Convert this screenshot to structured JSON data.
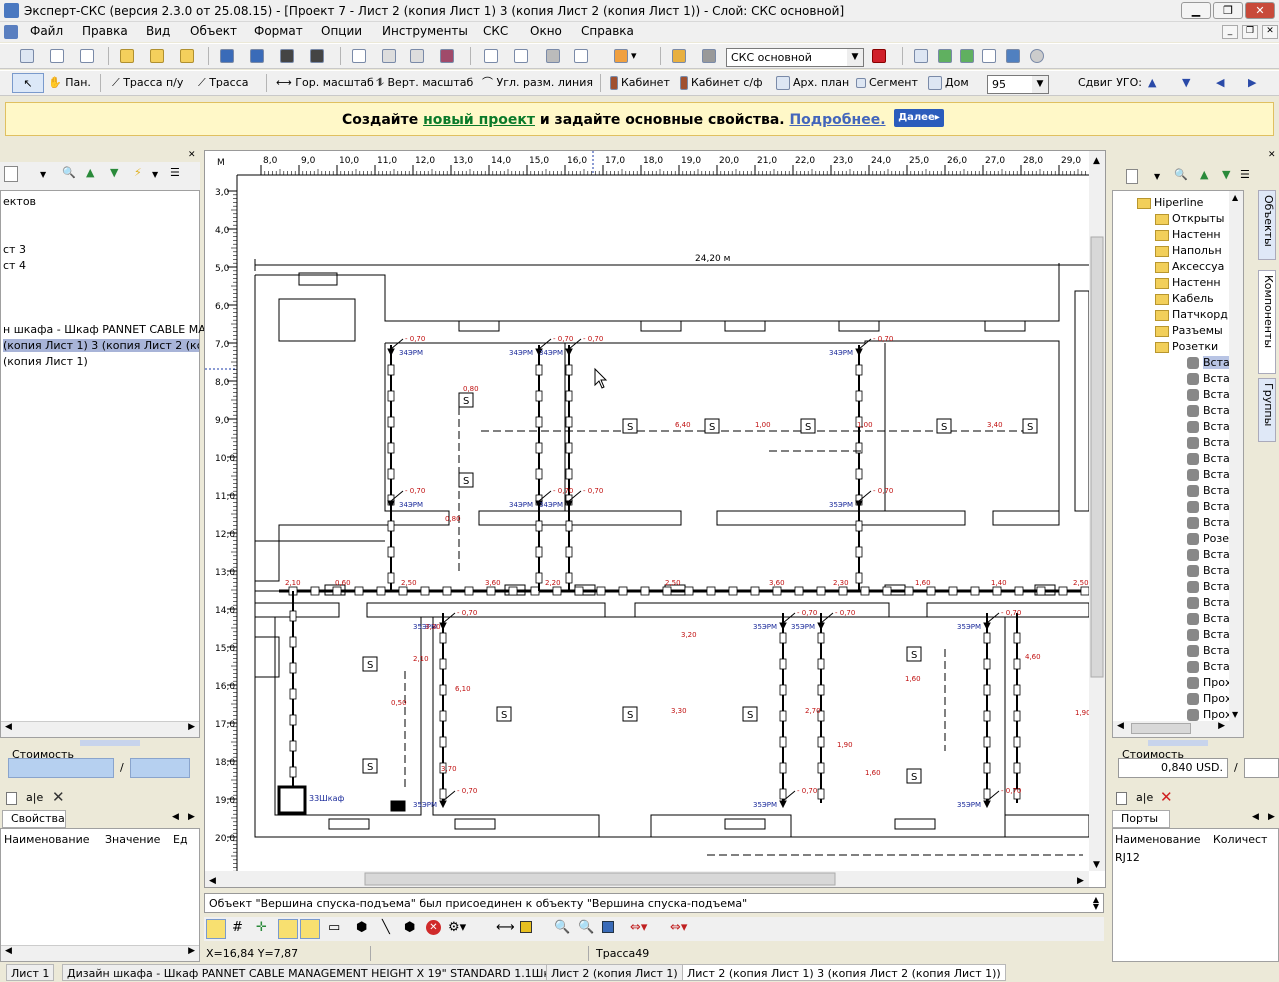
{
  "window": {
    "title": "Эксперт-СКС (версия  2.3.0 от 25.08.15) - [Проект 7 - Лист 2 (копия  Лист 1) 3 (копия  Лист 2 (копия  Лист 1))  - Слой: СКС основной]"
  },
  "menu": [
    "Файл",
    "Правка",
    "Вид",
    "Объект",
    "Формат",
    "Опции",
    "Инструменты",
    "СКС",
    "Окно",
    "Справка"
  ],
  "toolbar2": {
    "layer_value": "СКС основной",
    "tools": [
      "Пан.",
      "Трасса п/у",
      "Трасса",
      "Гор. масштаб",
      "Верт. масштаб",
      "Угл. разм. линия",
      "Кабинет",
      "Кабинет с/ф",
      "Арх. план",
      "Сегмент",
      "Дом"
    ],
    "zoom_value": "95",
    "shift_label": "Сдвиг УГО:"
  },
  "banner": {
    "part1": "Создайте",
    "link1": "новый проект",
    "part2": "и задайте основные свойства.",
    "link2": "Подробнее.",
    "next_label": "Далее"
  },
  "left_panel": {
    "items": [
      "ектов",
      "",
      "ст 3",
      "ст 4",
      "",
      "",
      "н шкафа - Шкаф PANNET CABLE MANA",
      "(копия  Лист 1) 3 (копия  Лист 2 (копи",
      "(копия  Лист 1)"
    ],
    "cost_label": "Стоимость",
    "cost_sep": "/",
    "props_tab": "Свойства",
    "props_cols": [
      "Наименование",
      "Значение",
      "Ед"
    ]
  },
  "canvas": {
    "unit": "М",
    "x_ticks": [
      "8,0",
      "9,0",
      "10,0",
      "11,0",
      "12,0",
      "13,0",
      "14,0",
      "15,0",
      "16,0",
      "17,0",
      "18,0",
      "19,0",
      "20,0",
      "21,0",
      "22,0",
      "23,0",
      "24,0",
      "25,0",
      "26,0",
      "27,0",
      "28,0",
      "29,0"
    ],
    "y_ticks": [
      "3,0",
      "4,0",
      "5,0",
      "6,0",
      "7,0",
      "8,0",
      "9,0",
      "10,0",
      "11,0",
      "12,0",
      "13,0",
      "14,0",
      "15,0",
      "16,0",
      "17,0",
      "18,0",
      "19,0",
      "20,0"
    ],
    "dimension_label": "24,20 м",
    "message": "Объект \"Вершина спуска-подъема\" был присоединен к объекту \"Вершина спуска-подъема\""
  },
  "right_panel": {
    "side_tabs": [
      "Объекты",
      "Компоненты",
      "Группы"
    ],
    "tree_root": "Hiperline",
    "tree_folders": [
      "Открыты",
      "Настенн",
      "Напольн",
      "Аксессуа",
      "Настенн",
      "Кабель",
      "Патчкорд",
      "Разъемы",
      "Розетки"
    ],
    "tree_items": [
      "Встав",
      "Встав",
      "Встав",
      "Встав",
      "Встав",
      "Встав",
      "Встав",
      "Встав",
      "Встав",
      "Встав",
      "Встав",
      "Розе",
      "Встав",
      "Встав",
      "Встав",
      "Встав",
      "Встав",
      "Встав",
      "Встав",
      "Встав",
      "Прох",
      "Прох",
      "Прох"
    ],
    "cost_label": "Стоимость",
    "cost_value": "0,840 USD.",
    "cost_sep": "/",
    "ports_tab": "Порты",
    "ports_cols": [
      "Наименование",
      "Количест"
    ],
    "ports_rows": [
      "RJ12"
    ]
  },
  "status": {
    "coords": "X=16,84  Y=7,87",
    "object": "Трасса49"
  },
  "tabs": [
    "Лист 1",
    "Дизайн шкафа - Шкаф PANNET CABLE MANAGEMENT HEIGHT X 19\" STANDARD 1.1Шкаф",
    "Лист 2 (копия  Лист 1)",
    "Лист 2 (копия  Лист 1) 3 (копия  Лист 2 (копия  Лист 1))"
  ],
  "drawing_labels": {
    "len_070": "0,70",
    "red_marks": [
      "2,10",
      "0,60",
      "2,50",
      "3,60",
      "2,20",
      "2,50",
      "3,60",
      "2,30",
      "1,60",
      "1,40",
      "2,50",
      "0,80",
      "6,40",
      "1,00",
      "1,00",
      "3,40",
      "0,80",
      "3,30",
      "2,10",
      "6,10",
      "0,50",
      "3,30",
      "3,20",
      "2,70",
      "1,90",
      "1,60",
      "3,70",
      "4,60",
      "1,60",
      "1,90"
    ],
    "outlets": [
      "34ЭРМ",
      "34ЭРМ",
      "34ЭРМ",
      "34ЭРМ",
      "34ЭРМ",
      "34ЭРМ",
      "34ЭРМ",
      "35ЭРМ",
      "35ЭРМ",
      "35ЭРМ",
      "35ЭРМ",
      "35ЭРМ",
      "35ЭРМ",
      "35ЭРМ",
      "35ЭРМ"
    ],
    "cabinet": "33Шкаф"
  }
}
